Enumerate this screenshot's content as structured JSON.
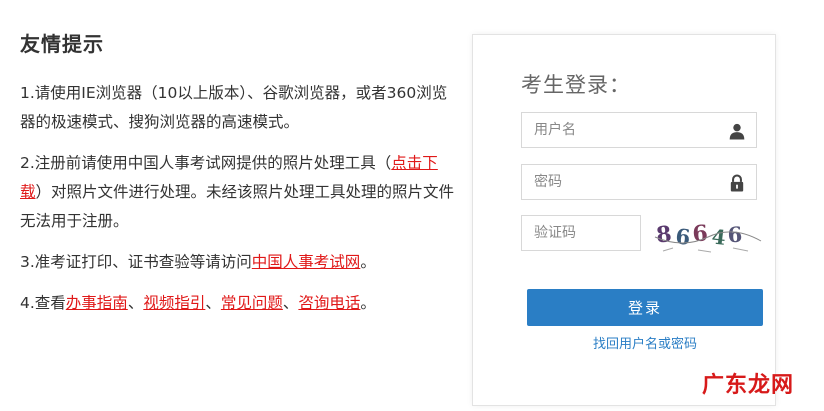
{
  "tips": {
    "title": "友情提示",
    "item1": {
      "text": "1.请使用IE浏览器（10以上版本）、谷歌浏览器，或者360浏览器的极速模式、搜狗浏览器的高速模式。"
    },
    "item2": {
      "prefix": "2.注册前请使用中国人事考试网提供的照片处理工具（",
      "link": "点击下载",
      "suffix": "）对照片文件进行处理。未经该照片处理工具处理的照片文件无法用于注册。"
    },
    "item3": {
      "prefix": "3.准考证打印、证书查验等请访问",
      "link": "中国人事考试网",
      "suffix": "。"
    },
    "item4": {
      "prefix": "4.查看",
      "links": [
        "办事指南",
        "视频指引",
        "常见问题",
        "咨询电话"
      ],
      "sep": "、",
      "suffix": "。"
    }
  },
  "login": {
    "title": "考生登录：",
    "username_placeholder": "用户名",
    "password_placeholder": "密码",
    "captcha_placeholder": "验证码",
    "captcha_text": "86646",
    "submit_label": "登录",
    "forgot_label": "找回用户名或密码"
  },
  "icons": {
    "username": "user-icon",
    "password": "lock-icon"
  },
  "colors": {
    "link_red": "#e01818",
    "button_blue": "#2a7ec5",
    "watermark_red": "#d71a1a"
  },
  "watermark": "广东龙网"
}
